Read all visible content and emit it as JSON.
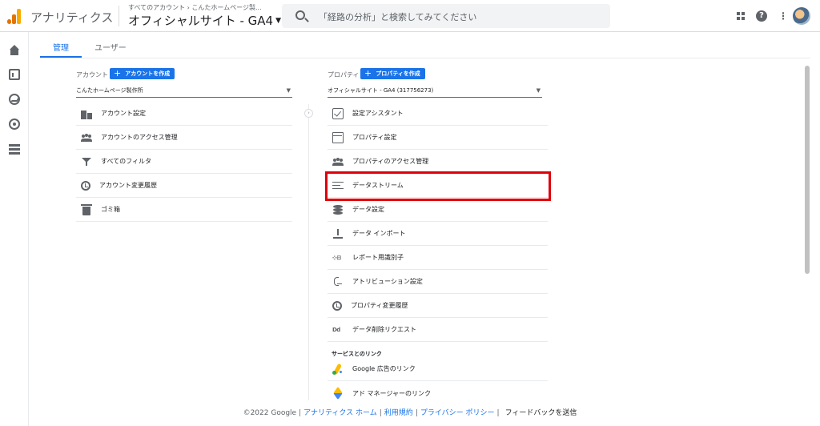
{
  "header": {
    "app_name": "アナリティクス",
    "breadcrumb": "すべてのアカウント › こんたホームページ製...",
    "property_title": "オフィシャルサイト - GA4",
    "search_placeholder": "「経路の分析」と検索してみてください",
    "icons": [
      "apps-icon",
      "help-icon",
      "more-vert-icon",
      "avatar"
    ]
  },
  "leftnav": {
    "icons": [
      "home-icon",
      "reports-icon",
      "explore-icon",
      "advertising-icon",
      "configure-icon",
      "settings-icon"
    ]
  },
  "tabs": [
    {
      "label": "管理",
      "active": true
    },
    {
      "label": "ユーザー",
      "active": false
    }
  ],
  "account": {
    "heading": "アカウント",
    "create_label": "アカウントを作成",
    "selected": "こんたホームページ製作所",
    "items": [
      {
        "label": "アカウント設定",
        "icon": "building-icon"
      },
      {
        "label": "アカウントのアクセス管理",
        "icon": "people-icon"
      },
      {
        "label": "すべてのフィルタ",
        "icon": "filter-icon"
      },
      {
        "label": "アカウント変更履歴",
        "icon": "history-icon"
      },
      {
        "label": "ゴミ箱",
        "icon": "trash-icon"
      }
    ]
  },
  "property": {
    "heading": "プロパティ",
    "create_label": "プロパティを作成",
    "selected": "オフィシャルサイト - GA4 (317756273)",
    "items": [
      {
        "label": "設定アシスタント",
        "icon": "checklist-icon"
      },
      {
        "label": "プロパティ設定",
        "icon": "layout-icon"
      },
      {
        "label": "プロパティのアクセス管理",
        "icon": "people-icon"
      },
      {
        "label": "データストリーム",
        "icon": "data-stream-icon",
        "highlighted": true
      },
      {
        "label": "データ設定",
        "icon": "database-icon"
      },
      {
        "label": "データ インポート",
        "icon": "upload-icon"
      },
      {
        "label": "レポート用識別子",
        "icon": "identity-icon",
        "icon_text": "⊹⊟"
      },
      {
        "label": "アトリビューション設定",
        "icon": "attribution-icon"
      },
      {
        "label": "プロパティ変更履歴",
        "icon": "history-icon"
      },
      {
        "label": "データ削除リクエスト",
        "icon": "dd-icon",
        "icon_text": "Dd"
      }
    ],
    "links_heading": "サービスとのリンク",
    "links": [
      {
        "label": "Google 広告のリンク",
        "icon": "google-ads-icon"
      },
      {
        "label": "アド マネージャーのリンク",
        "icon": "ad-manager-icon"
      }
    ]
  },
  "footer": {
    "copyright": "©2022 Google",
    "link_home": "アナリティクス ホーム",
    "link_terms": "利用規約",
    "link_privacy": "プライバシー ポリシー",
    "feedback": "フィードバックを送信"
  },
  "colors": {
    "accent": "#1a73e8",
    "highlight_box": "#e0000c",
    "logo_orange": "#f9ab00"
  }
}
